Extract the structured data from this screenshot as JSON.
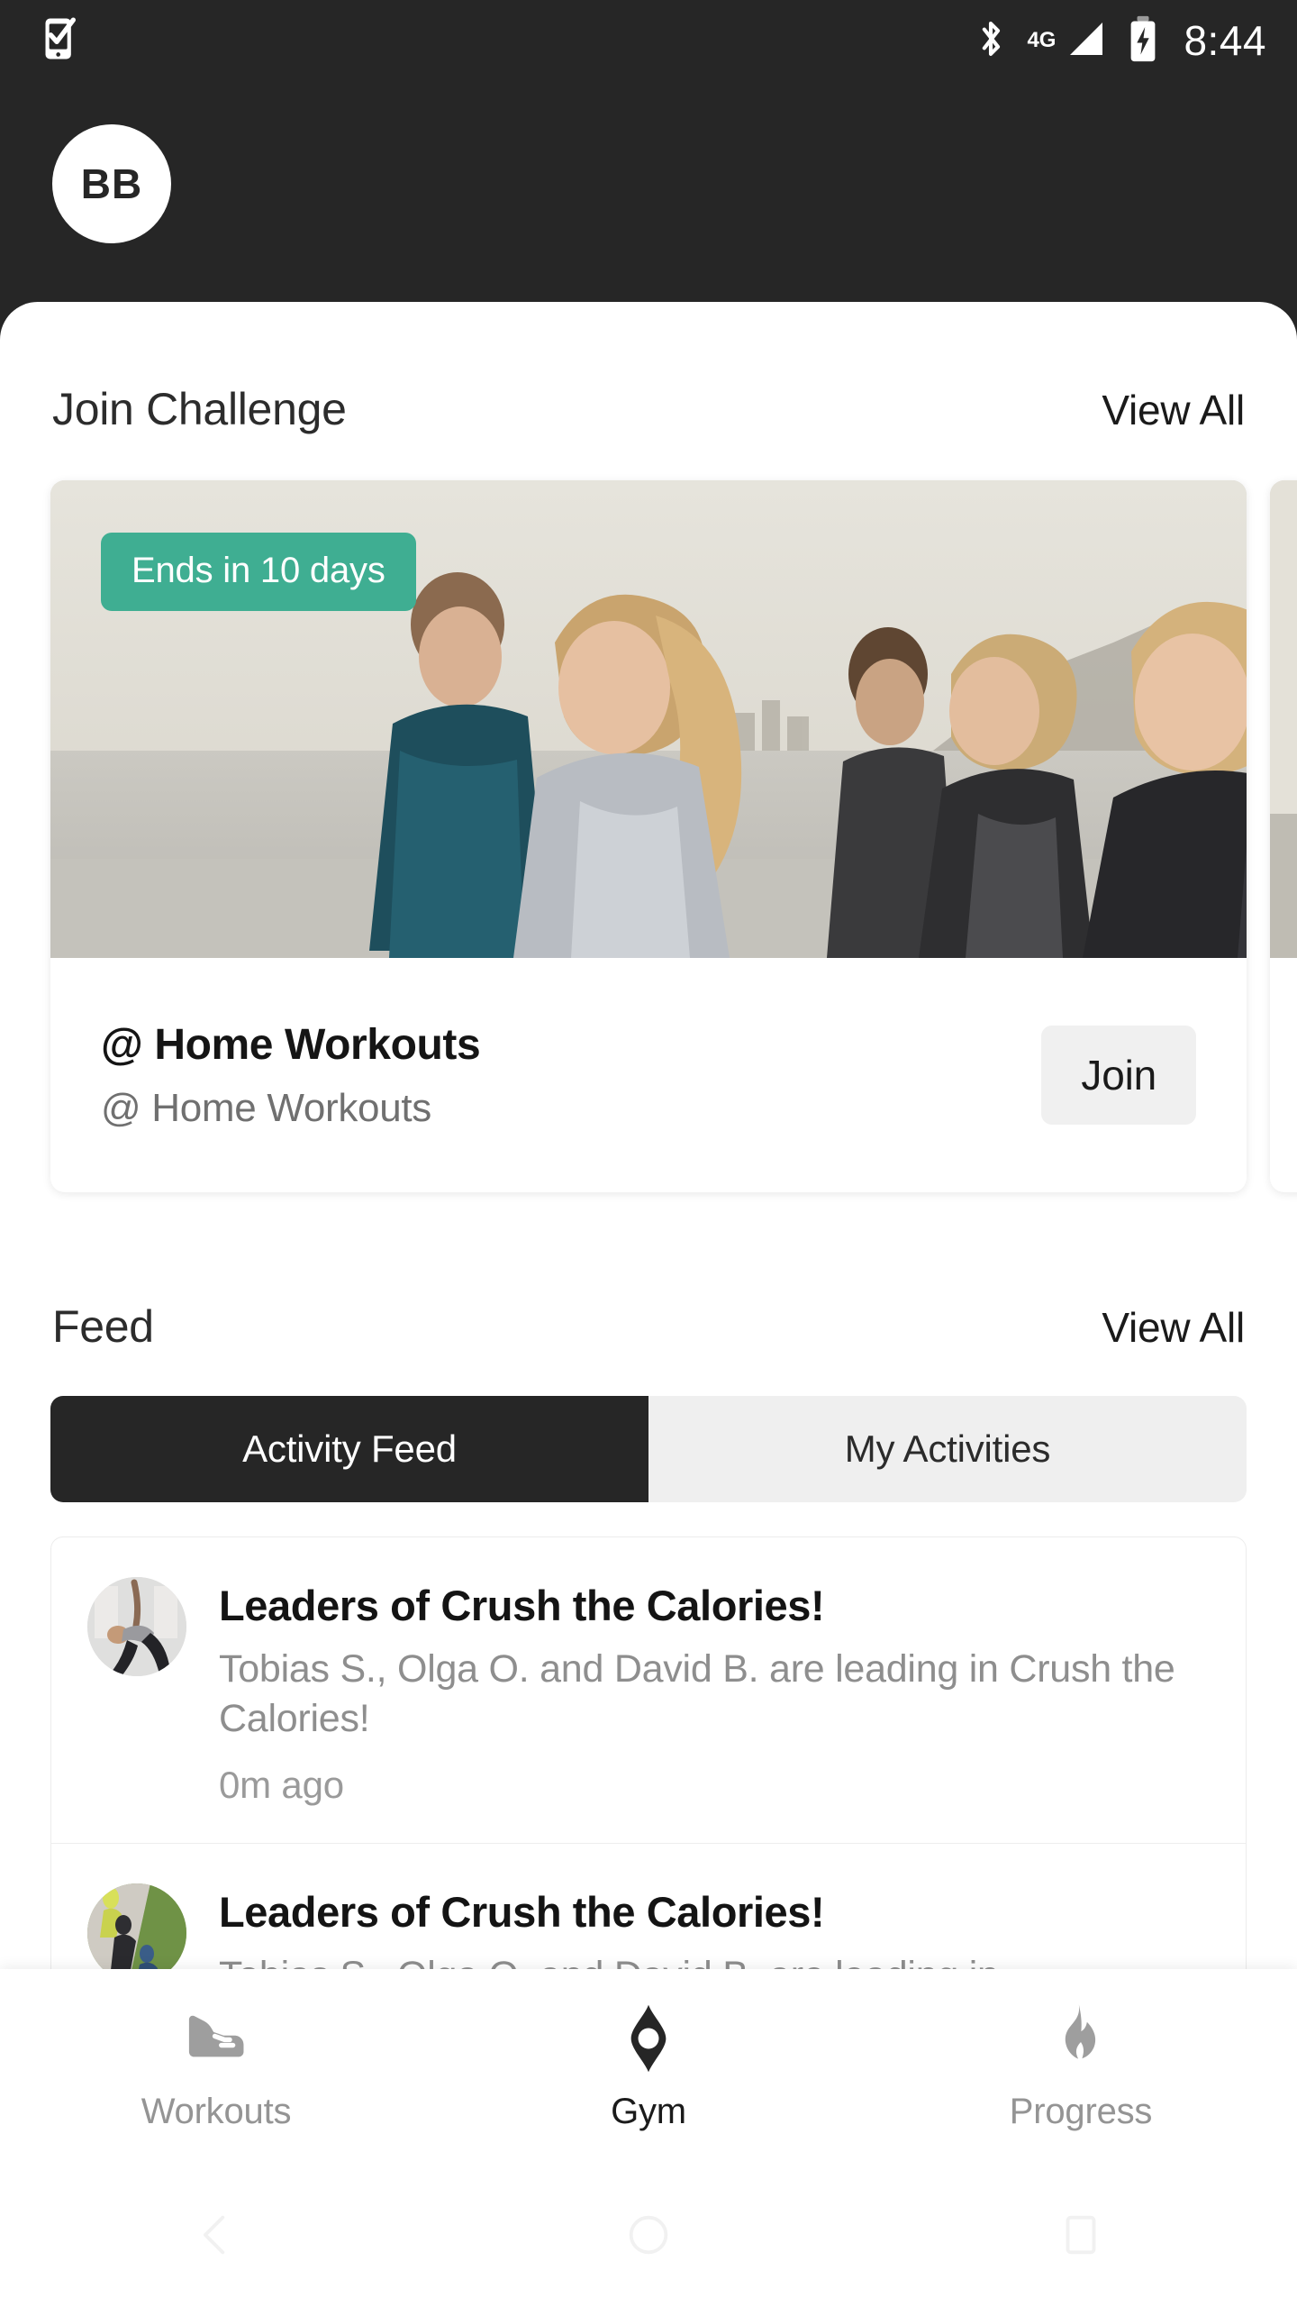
{
  "status_bar": {
    "time": "8:44",
    "network_label": "4G",
    "icons": [
      "mobile-check-icon",
      "bluetooth-icon",
      "signal-icon",
      "battery-charging-icon"
    ]
  },
  "header": {
    "avatar_initials": "BB"
  },
  "challenge_section": {
    "title": "Join Challenge",
    "view_all_label": "View All",
    "cards": [
      {
        "badge": "Ends in 10 days",
        "title": "@ Home Workouts",
        "subtitle": "@ Home Workouts",
        "action_label": "Join"
      }
    ]
  },
  "feed_section": {
    "title": "Feed",
    "view_all_label": "View All",
    "tabs": [
      {
        "label": "Activity Feed",
        "active": true
      },
      {
        "label": "My Activities",
        "active": false
      }
    ],
    "items": [
      {
        "title": "Leaders of Crush the Calories!",
        "description": "Tobias S., Olga O. and David B. are leading in Crush the Calories!",
        "time": "0m ago",
        "avatar": "yoga-pose-avatar"
      },
      {
        "title": "Leaders of Crush the Calories!",
        "description": "Tobias S., Olga O. and David B. are leading in",
        "time": "",
        "avatar": "runners-avatar"
      }
    ]
  },
  "tab_bar": {
    "tabs": [
      {
        "label": "Workouts",
        "icon": "shoe-icon",
        "active": false
      },
      {
        "label": "Gym",
        "icon": "gym-diamond-icon",
        "active": true
      },
      {
        "label": "Progress",
        "icon": "flame-icon",
        "active": false
      }
    ]
  },
  "android_nav": {
    "buttons": [
      "back-icon",
      "home-icon",
      "recents-icon"
    ]
  },
  "colors": {
    "header_dark": "#262626",
    "badge_teal": "#3FAE92",
    "tab_active": "#1b1b1b",
    "tab_inactive": "#949494",
    "muted_text": "#8e8e8e"
  }
}
